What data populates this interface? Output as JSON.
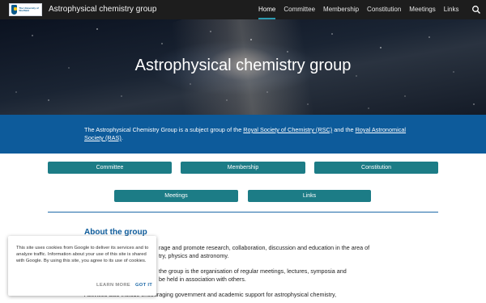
{
  "header": {
    "site_title": "Astrophysical chemistry group",
    "logo_text": "The University of Sheffield",
    "nav": [
      {
        "label": "Home",
        "active": true
      },
      {
        "label": "Committee",
        "active": false
      },
      {
        "label": "Membership",
        "active": false
      },
      {
        "label": "Constitution",
        "active": false
      },
      {
        "label": "Meetings",
        "active": false
      },
      {
        "label": "Links",
        "active": false
      }
    ],
    "search_icon": "search-icon"
  },
  "hero": {
    "title": "Astrophysical chemistry group"
  },
  "intro": {
    "text_before": "The Astrophysical Chemistry Group is a subject group of the ",
    "link1": "Royal Society of Chemistry (RSC)",
    "text_middle": " and the ",
    "link2": "Royal Astronomical Society (RAS)",
    "text_after": "."
  },
  "buttons": {
    "committee": "Committee",
    "membership": "Membership",
    "constitution": "Constitution",
    "meetings": "Meetings",
    "links": "Links"
  },
  "about": {
    "title": "About the group",
    "line1": "rage and promote research, collaboration, discussion and education in the area of",
    "line2": "try, physics and astronomy.",
    "line3": "the group is the organisation of regular meetings, lectures, symposia and",
    "line4": "be held in association with others.",
    "line5": "Activities also include encouraging government and academic support for astrophysical chemistry,"
  },
  "cookie": {
    "text": "This site uses cookies from Google to deliver its services and to analyze traffic. Information about your use of this site is shared with Google. By using this site, you agree to its use of cookies.",
    "learn_more": "LEARN MORE",
    "got_it": "GOT IT"
  },
  "colors": {
    "topbar": "#1d1d1d",
    "blue_band": "#0d5b9b",
    "button": "#1c7c86",
    "accent": "#2d9bb0"
  }
}
